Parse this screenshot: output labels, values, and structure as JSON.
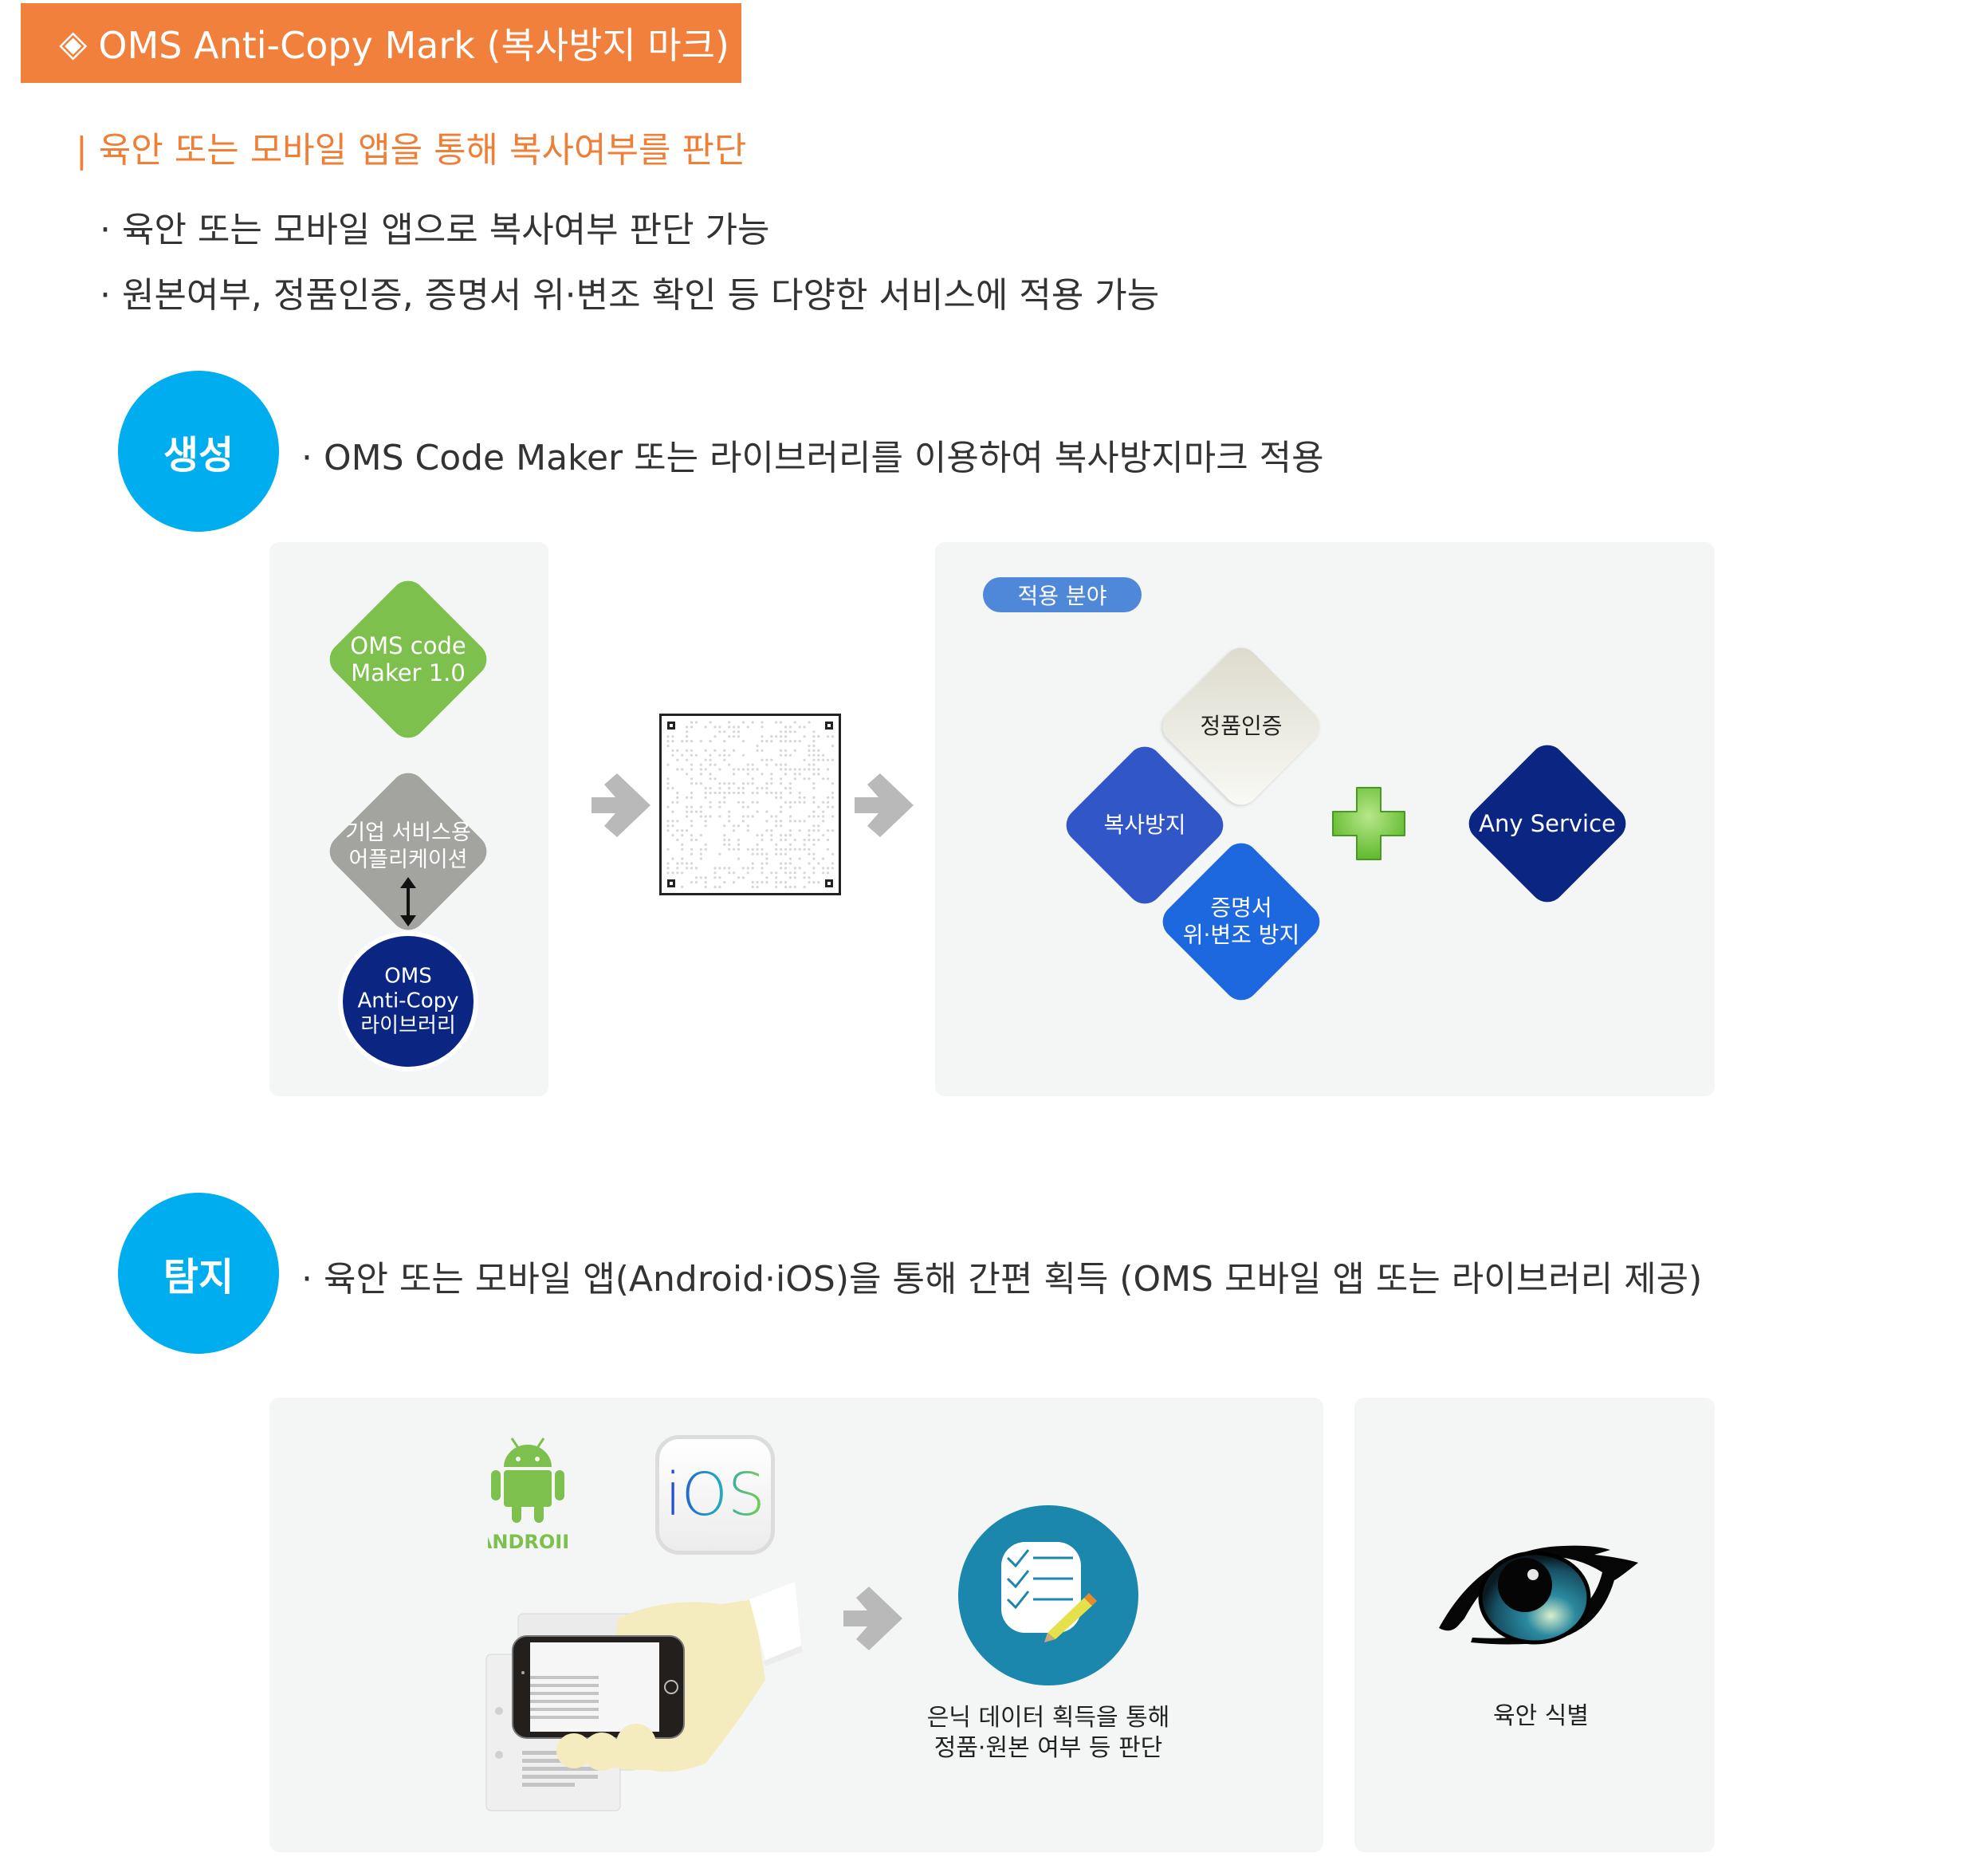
{
  "header": {
    "icon": "diamond-outline-icon",
    "diamond_glyph": "◈",
    "title": "OMS Anti-Copy Mark (복사방지 마크)",
    "bg_color": "#f0803c"
  },
  "subtitle": "| 육안 또는 모바일 앱을 통해 복사여부를 판단",
  "bullets": [
    "· 육안 또는 모바일 앱으로 복사여부 판단 가능",
    "· 원본여부, 정품인증, 증명서 위·변조 확인 등 다양한 서비스에 적용 가능"
  ],
  "sections": {
    "generate": {
      "badge": "생성",
      "description": "· OMS Code Maker 또는 라이브러리를 이용하여 복사방지마크 적용",
      "left_panel": {
        "code_maker": [
          "OMS code",
          "Maker 1.0"
        ],
        "enterprise_app": [
          "기업 서비스용",
          "어플리케이션"
        ],
        "library": [
          "OMS",
          "Anti-Copy",
          "라이브러리"
        ]
      },
      "right_panel": {
        "badge": "적용 분야",
        "items": [
          {
            "label": "정품인증"
          },
          {
            "label": "복사방지"
          },
          {
            "label": "증명서\n위·변조 방지"
          }
        ],
        "plus_icon": "plus-icon",
        "any_service": "Any Service"
      }
    },
    "detect": {
      "badge": "탐지",
      "description": "· 육안 또는 모바일 앱(Android·iOS)을 통해 간편 획득 (OMS 모바일 앱 또는 라이브러리 제공)",
      "android_label": "ANDROID",
      "ios_label": "iOS",
      "app_caption": [
        "은닉 데이터  획득을 통해",
        "정품·원본 여부 등 판단"
      ],
      "eye_caption": "육안 식별"
    }
  },
  "colors": {
    "accent_orange": "#f0803c",
    "step_cyan": "#00aeef",
    "green": "#7dc04e",
    "gray": "#a3a4a0",
    "navy": "#0a2582",
    "royal_blue": "#3156c7",
    "bright_blue": "#1d68de",
    "teal": "#1b87ad"
  }
}
